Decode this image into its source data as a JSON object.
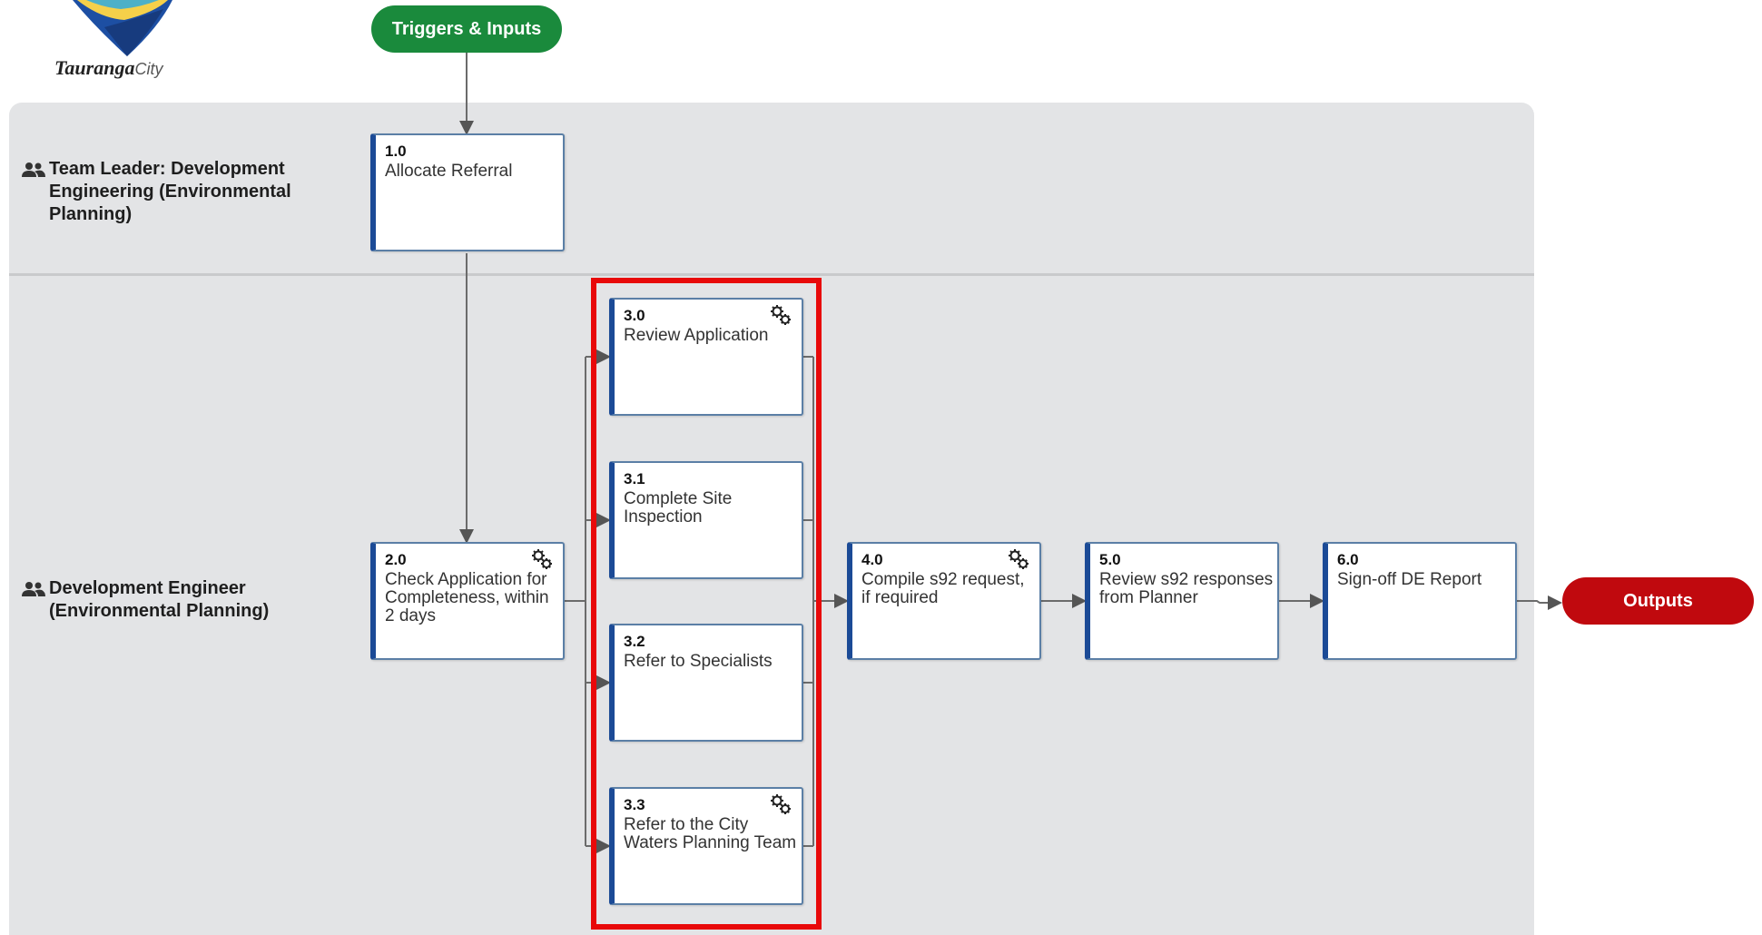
{
  "logo": {
    "name": "Tauranga",
    "suffix": "City"
  },
  "triggers_label": "Triggers & Inputs",
  "outputs_label": "Outputs",
  "lanes": [
    {
      "label": "Team Leader: Development Engineering (Environmental Planning)"
    },
    {
      "label": "Development Engineer (Environmental Planning)"
    }
  ],
  "steps": {
    "s10": {
      "num": "1.0",
      "title": "Allocate Referral",
      "gear": false
    },
    "s20": {
      "num": "2.0",
      "title": "Check Application for Completeness, within 2 days",
      "gear": true
    },
    "s30": {
      "num": "3.0",
      "title": "Review Application",
      "gear": true
    },
    "s31": {
      "num": "3.1",
      "title": "Complete Site Inspection",
      "gear": false
    },
    "s32": {
      "num": "3.2",
      "title": "Refer to Specialists",
      "gear": false
    },
    "s33": {
      "num": "3.3",
      "title": "Refer to the City Waters Planning Team",
      "gear": true
    },
    "s40": {
      "num": "4.0",
      "title": "Compile s92 request, if required",
      "gear": true
    },
    "s50": {
      "num": "5.0",
      "title": "Review s92 responses from Planner",
      "gear": false
    },
    "s60": {
      "num": "6.0",
      "title": "Sign-off DE Report",
      "gear": false
    }
  },
  "colors": {
    "triggers": "#1a8a3c",
    "outputs": "#c0090e",
    "box_accent": "#1b4a96",
    "highlight": "#e8090a",
    "lane": "#e3e4e6"
  }
}
